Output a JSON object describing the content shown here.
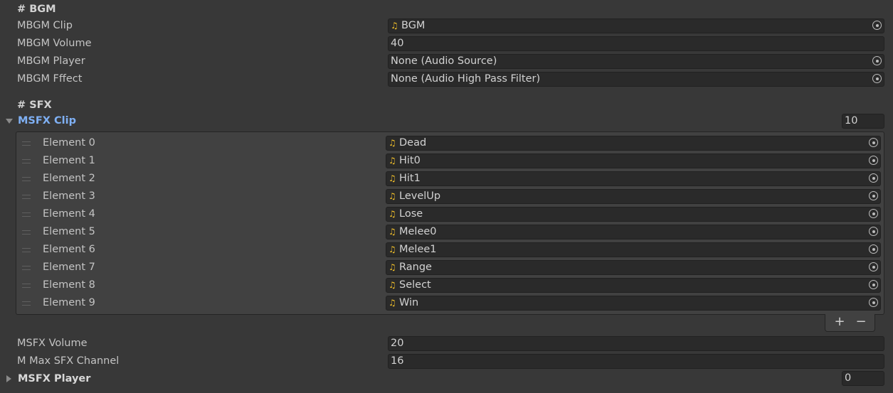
{
  "bgm": {
    "header": "# BGM",
    "clip": {
      "label": "MBGM Clip",
      "value": "BGM"
    },
    "volume": {
      "label": "MBGM Volume",
      "value": "40"
    },
    "player": {
      "label": "MBGM Player",
      "value": "None (Audio Source)"
    },
    "effect": {
      "label": "MBGM Fffect",
      "value": "None (Audio High Pass Filter)"
    }
  },
  "sfx": {
    "header": "# SFX",
    "clips": {
      "label": "MSFX Clip",
      "size": "10",
      "elements": [
        {
          "label": "Element 0",
          "value": "Dead"
        },
        {
          "label": "Element 1",
          "value": "Hit0"
        },
        {
          "label": "Element 2",
          "value": "Hit1"
        },
        {
          "label": "Element 3",
          "value": "LevelUp"
        },
        {
          "label": "Element 4",
          "value": "Lose"
        },
        {
          "label": "Element 5",
          "value": "Melee0"
        },
        {
          "label": "Element 6",
          "value": "Melee1"
        },
        {
          "label": "Element 7",
          "value": "Range"
        },
        {
          "label": "Element 8",
          "value": "Select"
        },
        {
          "label": "Element 9",
          "value": "Win"
        }
      ],
      "add_label": "+",
      "remove_label": "−"
    },
    "volume": {
      "label": "MSFX Volume",
      "value": "20"
    },
    "max_channel": {
      "label": "M Max SFX Channel",
      "value": "16"
    },
    "player": {
      "label": "MSFX Player",
      "size": "0"
    }
  },
  "icons": {
    "audio_clip": "music-note-icon",
    "object_picker": "object-picker-icon",
    "drag_handle": "drag-handle-icon"
  },
  "colors": {
    "background": "#383838",
    "field": "#2a2a2a",
    "active_foldout": "#7fb0f4",
    "audio_icon": "#f4c22a"
  }
}
